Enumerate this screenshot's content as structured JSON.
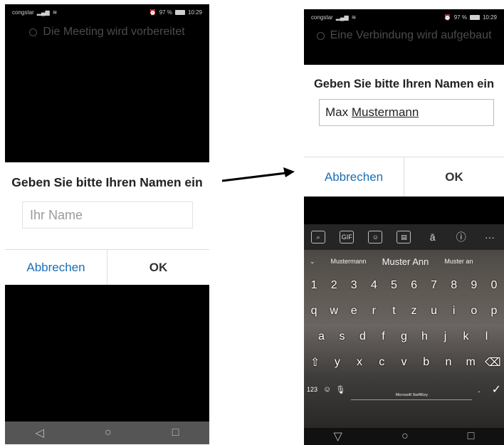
{
  "left": {
    "status": {
      "carrier": "congstar",
      "battery_pct": "97 %",
      "time": "10:29"
    },
    "connecting_text": "Die Meeting wird vorbereitet",
    "dialog": {
      "title": "Geben Sie bitte Ihren Namen ein",
      "input_placeholder": "Ihr Name",
      "input_value": "",
      "cancel": "Abbrechen",
      "ok": "OK"
    },
    "nav": {
      "back": "◁",
      "home": "○",
      "recent": "□"
    }
  },
  "right": {
    "status": {
      "carrier": "congstar",
      "battery_pct": "97 %",
      "time": "10:29"
    },
    "connecting_text": "Eine Verbindung wird aufgebaut",
    "dialog": {
      "title": "Geben Sie bitte Ihren Namen ein",
      "input_first": "Max ",
      "input_last": "Mustermann",
      "cancel": "Abbrechen",
      "ok": "OK"
    },
    "keyboard": {
      "toolbar": [
        "⌕",
        "GIF",
        "☺",
        "▤",
        "ā",
        "ⓘ",
        "···"
      ],
      "suggestions": [
        "Mustermann",
        "Muster Ann",
        "Muster an"
      ],
      "row_numbers": [
        "1",
        "2",
        "3",
        "4",
        "5",
        "6",
        "7",
        "8",
        "9",
        "0"
      ],
      "row_q": [
        "q",
        "w",
        "e",
        "r",
        "t",
        "z",
        "u",
        "i",
        "o",
        "p"
      ],
      "row_a": [
        "a",
        "s",
        "d",
        "f",
        "g",
        "h",
        "j",
        "k",
        "l"
      ],
      "row_y": [
        "⇧",
        "y",
        "x",
        "c",
        "v",
        "b",
        "n",
        "m",
        "⌫"
      ],
      "symbols_key": "123",
      "emoji_key": "☺",
      "space_label": "Microsoft SwiftKey",
      "period_key": ".",
      "enter_key": "✓"
    },
    "nav": {
      "back": "▽",
      "home": "○",
      "recent": "□"
    }
  },
  "colors": {
    "link_blue": "#1a6fb5",
    "dialog_bg": "#ffffff",
    "screen_bg": "#000000"
  }
}
